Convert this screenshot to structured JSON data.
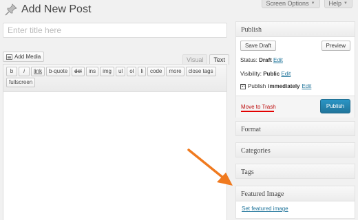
{
  "header": {
    "screen_options": "Screen Options",
    "help": "Help"
  },
  "page": {
    "title": "Add New Post"
  },
  "post": {
    "title_placeholder": "Enter title here"
  },
  "editor": {
    "add_media": "Add Media",
    "tabs": [
      "Visual",
      "Text"
    ],
    "active_tab": "Text",
    "quicktags": [
      "b",
      "i",
      "link",
      "b-quote",
      "del",
      "ins",
      "img",
      "ul",
      "ol",
      "li",
      "code",
      "more",
      "close tags",
      "fullscreen"
    ]
  },
  "publish": {
    "title": "Publish",
    "save_draft": "Save Draft",
    "preview": "Preview",
    "status_label": "Status:",
    "status_value": "Draft",
    "visibility_label": "Visibility:",
    "visibility_value": "Public",
    "publish_label": "Publish",
    "publish_value": "immediately",
    "edit": "Edit",
    "move_to_trash": "Move to Trash",
    "publish_button": "Publish"
  },
  "boxes": {
    "format": "Format",
    "categories": "Categories",
    "tags": "Tags",
    "featured_image": "Featured Image",
    "set_featured_image": "Set featured image"
  },
  "colors": {
    "accent": "#21759b",
    "annotation_arrow": "#f07a1f",
    "trash_underline": "#e30000"
  }
}
